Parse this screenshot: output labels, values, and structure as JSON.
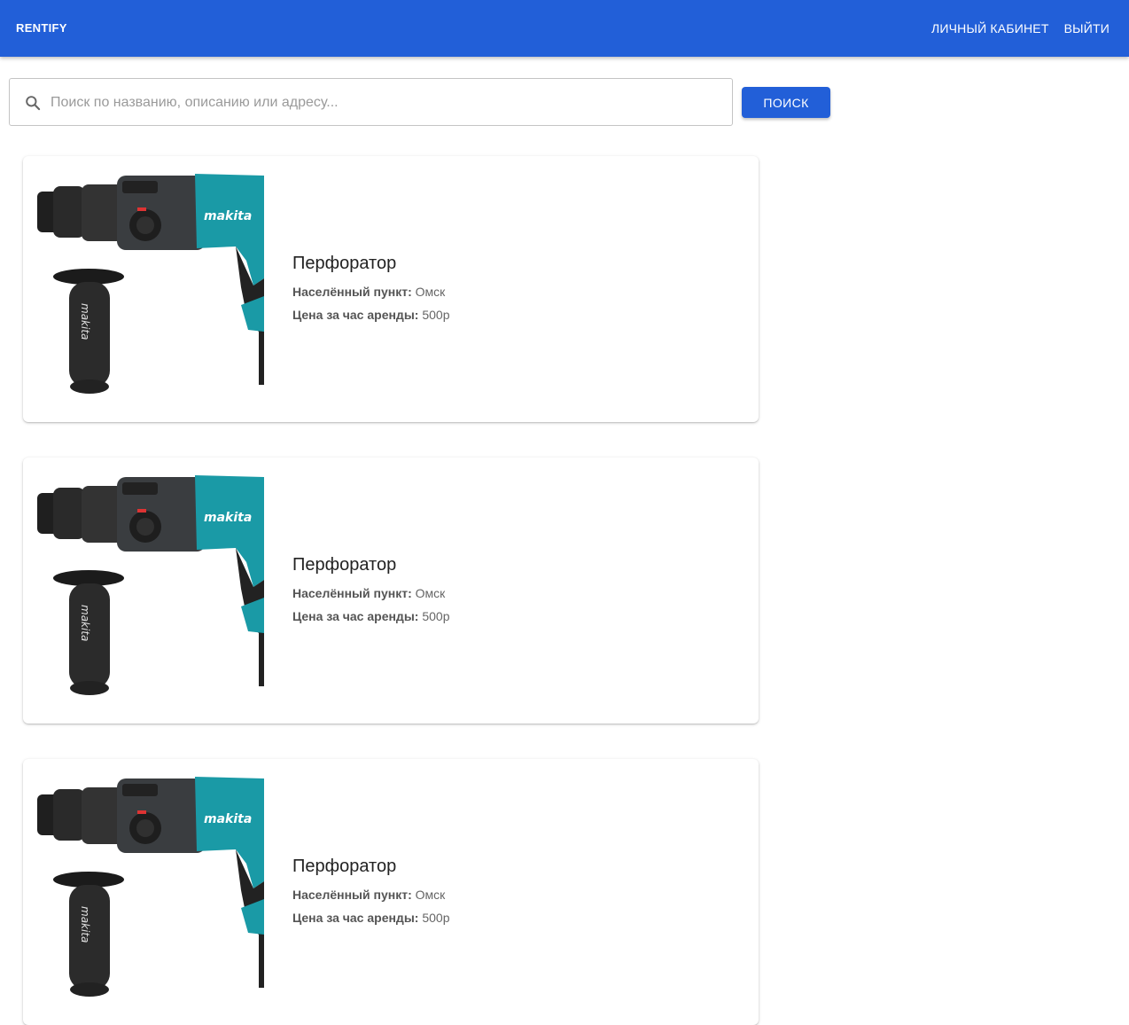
{
  "header": {
    "brand": "RENTIFY",
    "nav": [
      {
        "label": "ЛИЧНЫЙ КАБИНЕТ"
      },
      {
        "label": "ВЫЙТИ"
      }
    ]
  },
  "search": {
    "placeholder": "Поиск по названию, описанию или адресу...",
    "value": "",
    "button_label": "ПОИСК"
  },
  "listings": [
    {
      "title": "Перфоратор",
      "location_label": "Населённый пункт:",
      "location": "Омск",
      "price_label": "Цена за час аренды:",
      "price": "500р"
    },
    {
      "title": "Перфоратор",
      "location_label": "Населённый пункт:",
      "location": "Омск",
      "price_label": "Цена за час аренды:",
      "price": "500р"
    },
    {
      "title": "Перфоратор",
      "location_label": "Населённый пункт:",
      "location": "Омск",
      "price_label": "Цена за час аренды:",
      "price": "500р"
    }
  ],
  "colors": {
    "primary": "#225fd8",
    "tool_teal": "#1a9aa6",
    "tool_dark": "#2b2b2b"
  },
  "icons": {
    "search": "search-icon",
    "product": "hammer-drill-image"
  }
}
